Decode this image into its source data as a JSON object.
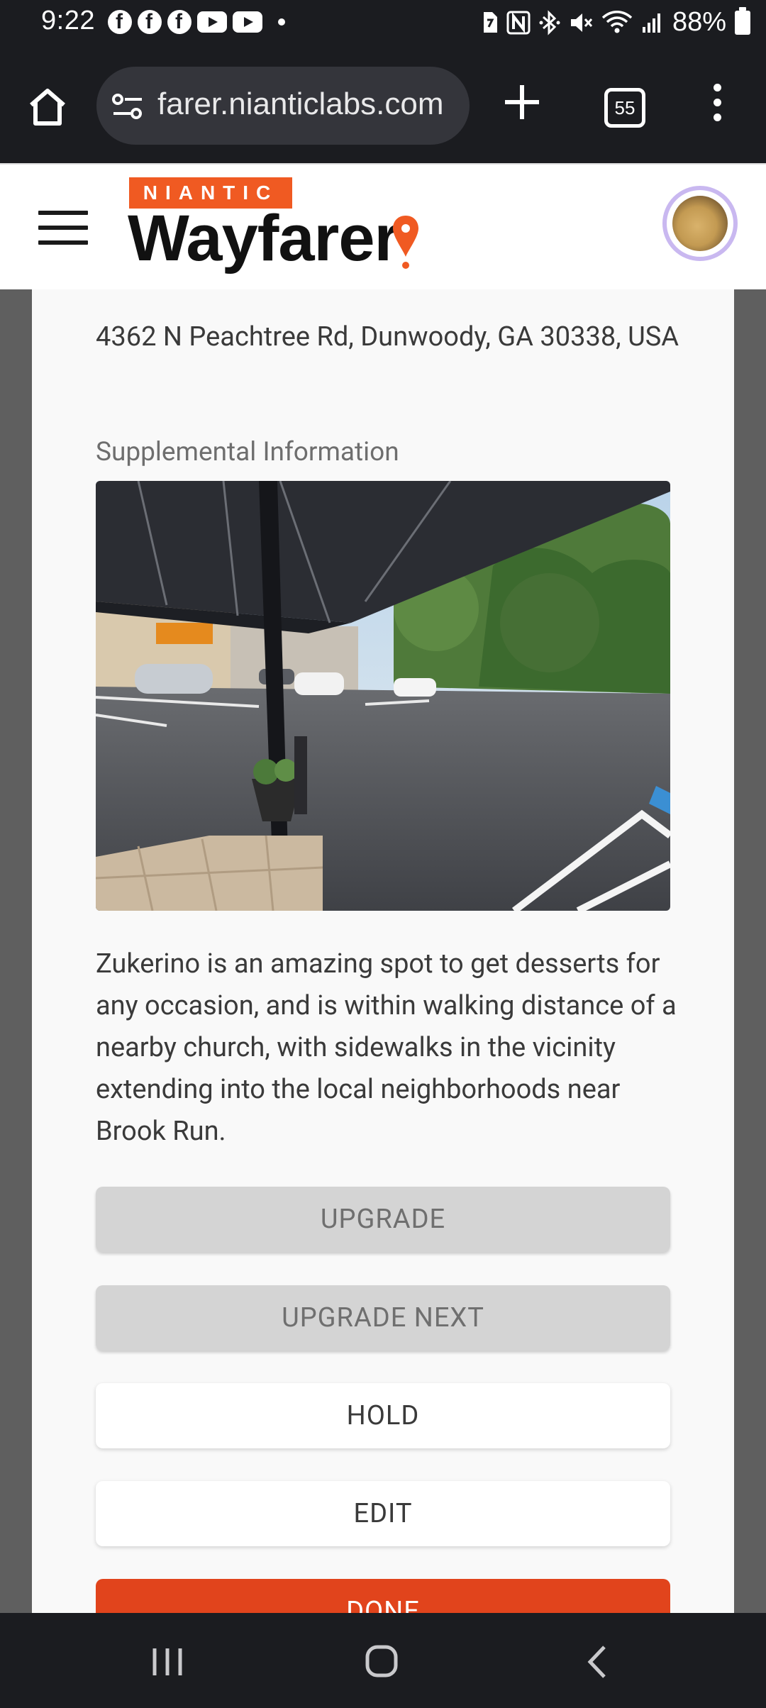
{
  "status_bar": {
    "time": "9:22",
    "battery": "88%",
    "icons": [
      "facebook-icon",
      "facebook-icon",
      "facebook-icon",
      "youtube-icon",
      "youtube-icon",
      "dot-icon",
      "sim-icon",
      "nfc-icon",
      "bluetooth-icon",
      "mute-icon",
      "wifi-icon",
      "signal-icon",
      "battery-icon"
    ]
  },
  "browser": {
    "url": "farer.nianticlabs.com",
    "tab_count": "55"
  },
  "header": {
    "brand_badge": "NIANTIC",
    "brand_name": "Wayfarer",
    "accent_color": "#f05a22"
  },
  "content": {
    "address": "4362 N Peachtree Rd, Dunwoody, GA 30338, USA",
    "supplemental_label": "Supplemental Information",
    "description": "Zukerino is an amazing spot to get desserts for any occasion, and is within walking distance of a nearby church, with sidewalks in the vicinity extending into the local neighborhoods near Brook Run."
  },
  "buttons": {
    "upgrade": "UPGRADE",
    "upgrade_next": "UPGRADE NEXT",
    "hold": "HOLD",
    "edit": "EDIT",
    "done": "DONE"
  }
}
